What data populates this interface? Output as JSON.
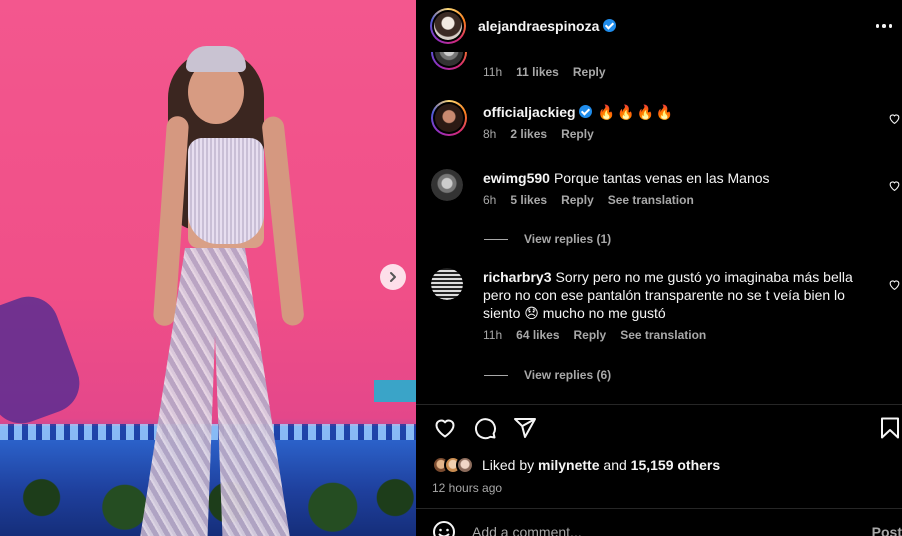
{
  "post": {
    "author": "alejandraespinoza",
    "author_verified": true,
    "more_icon": "more-horizontal-icon",
    "next_icon": "chevron-right-icon"
  },
  "comments": {
    "partial": {
      "time": "11h",
      "likes": "11 likes",
      "reply": "Reply"
    },
    "items": [
      {
        "username": "officialjackieg",
        "verified": true,
        "text": "",
        "emoji": "🔥🔥🔥🔥",
        "time": "8h",
        "likes": "2 likes",
        "reply": "Reply",
        "translation": ""
      },
      {
        "username": "ewimg590",
        "verified": false,
        "text": "Porque tantas venas en las Manos",
        "time": "6h",
        "likes": "5 likes",
        "reply": "Reply",
        "translation": "See translation",
        "view_replies": "View replies (1)"
      },
      {
        "username": "richarbry3",
        "verified": false,
        "text": "Sorry pero no me gustó yo imaginaba más bella pero no con ese pantalón transparente no se t veía bien lo siento 😞 mucho no me gustó",
        "time": "11h",
        "likes": "64 likes",
        "reply": "Reply",
        "translation": "See translation",
        "view_replies": "View replies (6)"
      }
    ]
  },
  "actions": {
    "like_icon": "heart-icon",
    "comment_icon": "comment-icon",
    "share_icon": "share-icon",
    "save_icon": "bookmark-icon"
  },
  "likes": {
    "prefix": "Liked by",
    "first_user": "milynette",
    "joiner": "and",
    "others": "15,159 others"
  },
  "timestamp": "12 hours ago",
  "composer": {
    "placeholder": "Add a comment...",
    "post_label": "Post",
    "emoji_icon": "emoji-icon"
  },
  "colors": {
    "background": "#000000",
    "text": "#f5f5f5",
    "muted": "#a8a8a8",
    "verified": "#1f8ceb",
    "divider": "#262626"
  }
}
